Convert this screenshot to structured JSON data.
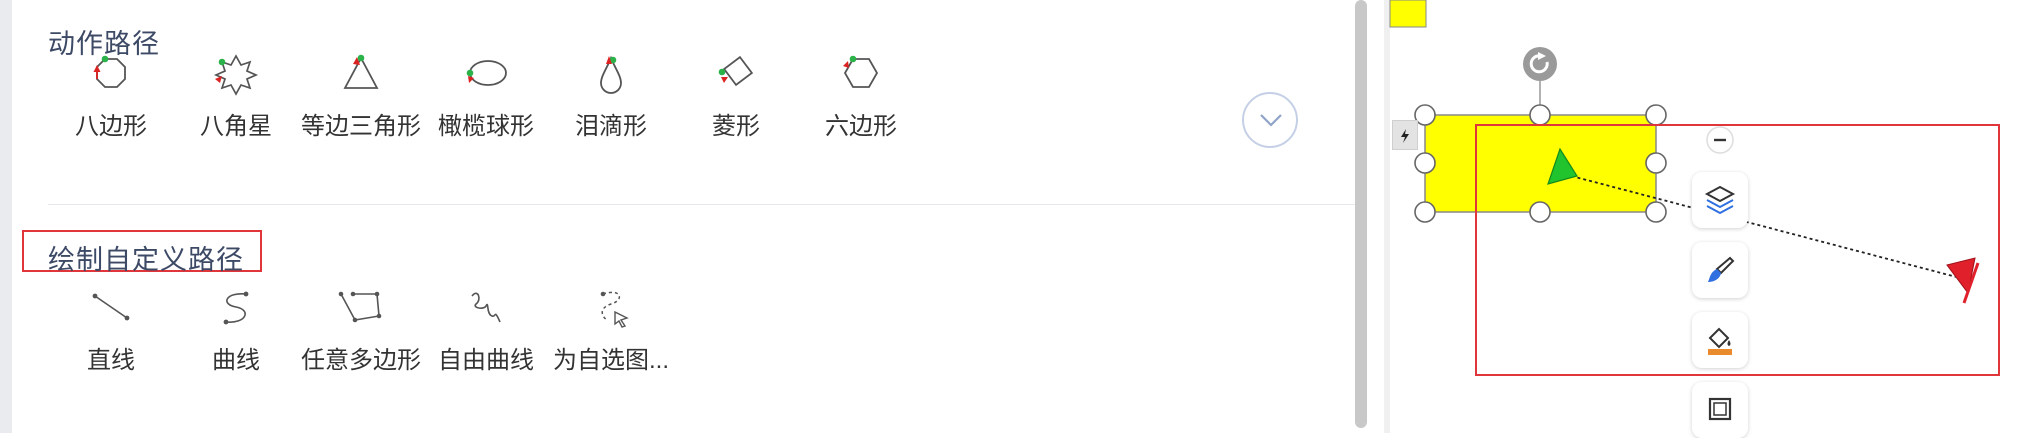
{
  "motion_paths": {
    "title": "动作路径",
    "items": [
      {
        "label": "八边形",
        "icon": "octagon-path-icon"
      },
      {
        "label": "八角星",
        "icon": "eight-point-star-path-icon"
      },
      {
        "label": "等边三角形",
        "icon": "triangle-path-icon"
      },
      {
        "label": "橄榄球形",
        "icon": "football-path-icon"
      },
      {
        "label": "泪滴形",
        "icon": "teardrop-path-icon"
      },
      {
        "label": "菱形",
        "icon": "diamond-path-icon"
      },
      {
        "label": "六边形",
        "icon": "hexagon-path-icon"
      }
    ],
    "more_icon": "chevron-down-icon"
  },
  "custom_paths": {
    "title": "绘制自定义路径",
    "items": [
      {
        "label": "直线",
        "icon": "straight-line-path-icon"
      },
      {
        "label": "曲线",
        "icon": "curve-path-icon"
      },
      {
        "label": "任意多边形",
        "icon": "freeform-polygon-path-icon"
      },
      {
        "label": "自由曲线",
        "icon": "scribble-path-icon"
      },
      {
        "label": "为自选图...",
        "icon": "shape-to-path-icon"
      }
    ]
  },
  "canvas": {
    "shape_fill": "#ffff00",
    "path_start_color": "#22c42e",
    "path_end_color": "#e0202a",
    "highlight_color": "#e0353b"
  },
  "floating_toolbar": {
    "buttons": [
      "minus-icon",
      "layers-icon",
      "brush-icon",
      "fill-bucket-icon",
      "border-icon"
    ]
  }
}
